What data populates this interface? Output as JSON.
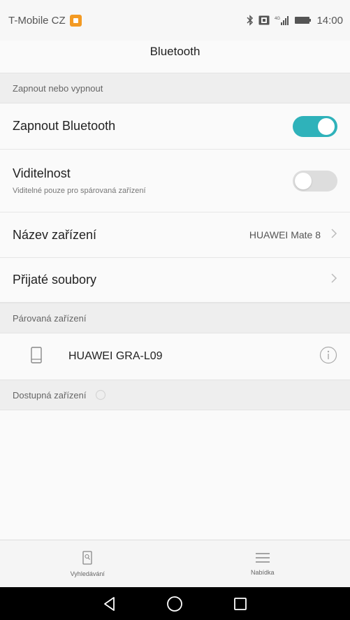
{
  "status_bar": {
    "carrier": "T-Mobile CZ",
    "time": "14:00",
    "icons": [
      "notification-icon",
      "bluetooth-icon",
      "nfc-icon",
      "signal-icon",
      "battery-icon"
    ]
  },
  "title": "Bluetooth",
  "sections": {
    "toggle_header": "Zapnout nebo vypnout",
    "paired_header": "Párovaná zařízení",
    "available_header": "Dostupná zařízení"
  },
  "settings": {
    "bluetooth": {
      "label": "Zapnout Bluetooth",
      "enabled": true
    },
    "visibility": {
      "label": "Viditelnost",
      "sublabel": "Viditelné pouze pro spárovaná zařízení",
      "enabled": false
    },
    "device_name": {
      "label": "Název zařízení",
      "value": "HUAWEI Mate 8"
    },
    "received_files": {
      "label": "Přijaté soubory"
    }
  },
  "paired_devices": [
    {
      "name": "HUAWEI GRA-L09",
      "icon": "phone-icon"
    }
  ],
  "bottom_nav": {
    "search_label": "Vyhledávání",
    "menu_label": "Nabídka"
  },
  "colors": {
    "accent": "#2fb2ba",
    "toggle_off": "#dddddd",
    "section_bg": "#eeeeee",
    "carrier_badge": "#f39a23"
  }
}
